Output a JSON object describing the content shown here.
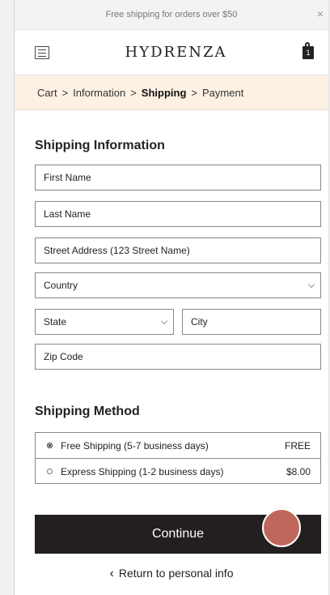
{
  "promo": {
    "text": "Free shipping for orders over $50",
    "close_icon": "×"
  },
  "header": {
    "logo_text": "HYDRENZA",
    "logo_swash": "Y",
    "cart_count": "1"
  },
  "breadcrumb": [
    {
      "label": "Cart",
      "current": false
    },
    {
      "label": "Information",
      "current": false
    },
    {
      "label": "Shipping",
      "current": true
    },
    {
      "label": "Payment",
      "current": false
    }
  ],
  "shipping_info": {
    "title": "Shipping Information",
    "first_name": "First Name",
    "last_name": "Last Name",
    "street": "Street Address (123 Street Name)",
    "country": "Country",
    "state": "State",
    "city": "City",
    "zip": "Zip Code"
  },
  "shipping_method": {
    "title": "Shipping Method",
    "options": [
      {
        "label": "Free Shipping (5-7 business days)",
        "price": "FREE",
        "selected": true
      },
      {
        "label": "Express Shipping (1-2 business days)",
        "price": "$8.00",
        "selected": false
      }
    ]
  },
  "actions": {
    "continue_label": "Continue",
    "return_label": "Return to personal info"
  },
  "colors": {
    "breadcrumb_bg": "#fdf1e3",
    "button_bg": "#231f20",
    "tap_indicator": "#c0675c"
  }
}
